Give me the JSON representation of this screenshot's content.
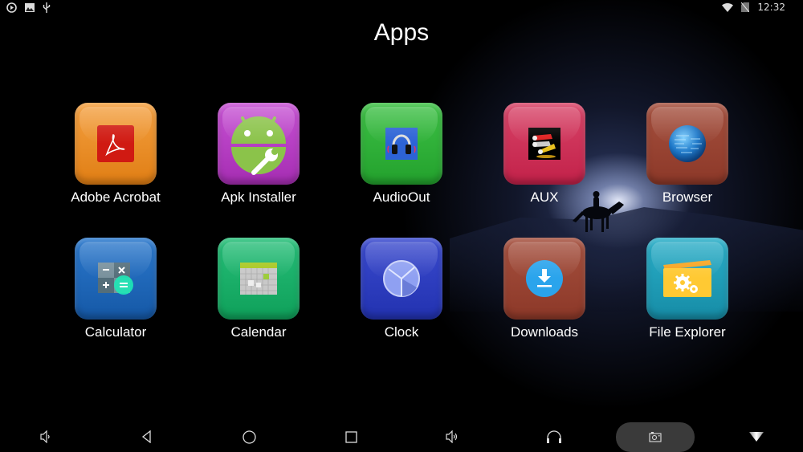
{
  "status_bar": {
    "left_icons": [
      "play-circle-icon",
      "image-icon",
      "usb-icon"
    ],
    "right_icons": [
      "wifi-icon",
      "no-sim-icon"
    ],
    "time": "12:32"
  },
  "page": {
    "title": "Apps"
  },
  "apps": [
    {
      "label": "Adobe Acrobat",
      "icon": "adobe-acrobat-icon",
      "color": "#E8891E"
    },
    {
      "label": "Apk Installer",
      "icon": "apk-installer-icon",
      "color": "#B23CC0"
    },
    {
      "label": "AudioOut",
      "icon": "audio-out-icon",
      "color": "#2EA834"
    },
    {
      "label": "AUX",
      "icon": "aux-icon",
      "color": "#C92B52"
    },
    {
      "label": "Browser",
      "icon": "browser-icon",
      "color": "#97402F"
    },
    {
      "label": "Calculator",
      "icon": "calculator-icon",
      "color": "#1C64B7"
    },
    {
      "label": "Calendar",
      "icon": "calendar-icon",
      "color": "#16A862"
    },
    {
      "label": "Clock",
      "icon": "clock-icon",
      "color": "#2B3BC0"
    },
    {
      "label": "Downloads",
      "icon": "downloads-icon",
      "color": "#97402F"
    },
    {
      "label": "File Explorer",
      "icon": "file-explorer-icon",
      "color": "#1E9BB4"
    }
  ],
  "nav_bar": {
    "buttons": [
      "volume-down-icon",
      "back-icon",
      "home-icon",
      "recents-icon",
      "volume-up-icon",
      "headphones-icon",
      "screenshot-icon",
      "hide-bar-icon"
    ]
  }
}
